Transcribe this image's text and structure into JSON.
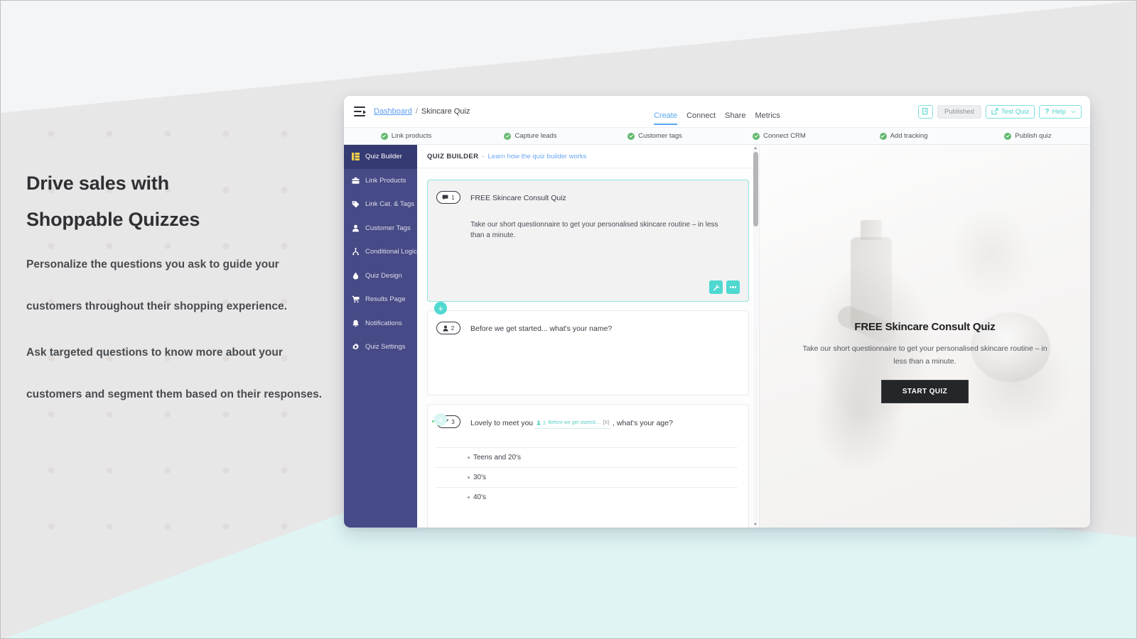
{
  "marketing": {
    "heading_line1": "Drive sales with",
    "heading_line2": "Shoppable Quizzes",
    "paragraph1": "Personalize the questions you ask to guide your customers throughout their shopping experience.",
    "paragraph2": "Ask targeted questions to know more about your customers and segment them based on their responses."
  },
  "topbar": {
    "menu_icon": "hamburger-menu-icon",
    "breadcrumb": {
      "root": "Dashboard",
      "separator": "/",
      "current": "Skincare Quiz"
    },
    "nav": [
      {
        "label": "Create",
        "active": true
      },
      {
        "label": "Connect",
        "active": false
      },
      {
        "label": "Share",
        "active": false
      },
      {
        "label": "Metrics",
        "active": false
      }
    ],
    "actions": {
      "duplicate_icon": "copy-page-icon",
      "published_label": "Published",
      "test_quiz_label": "Test Quiz",
      "test_quiz_icon": "external-link-icon",
      "help_label": "Help",
      "help_icon": "question-mark-icon",
      "help_chevron_icon": "chevron-down-icon"
    }
  },
  "checklist": [
    {
      "label": "Link products",
      "done": true
    },
    {
      "label": "Capture leads",
      "done": true
    },
    {
      "label": "Customer tags",
      "done": true
    },
    {
      "label": "Connect CRM",
      "done": true
    },
    {
      "label": "Add tracking",
      "done": true
    },
    {
      "label": "Publish quiz",
      "done": true
    }
  ],
  "sidebar": {
    "items": [
      {
        "label": "Quiz Builder",
        "icon": "grid-blocks-icon",
        "active": true
      },
      {
        "label": "Link Products",
        "icon": "briefcase-icon",
        "active": false
      },
      {
        "label": "Link Cat. & Tags",
        "icon": "tag-icon",
        "active": false
      },
      {
        "label": "Customer Tags",
        "icon": "person-icon",
        "active": false
      },
      {
        "label": "Conditional Logic",
        "icon": "branch-icon",
        "active": false
      },
      {
        "label": "Quiz Design",
        "icon": "droplet-icon",
        "active": false
      },
      {
        "label": "Results Page",
        "icon": "shopping-cart-icon",
        "active": false
      },
      {
        "label": "Notifications",
        "icon": "bell-icon",
        "active": false
      },
      {
        "label": "Quiz Settings",
        "icon": "gear-icon",
        "active": false
      }
    ]
  },
  "builder": {
    "header_title": "QUIZ BUILDER",
    "header_dash": "-",
    "header_link": "Learn how the quiz builder works",
    "cards": [
      {
        "badge_number": "1",
        "badge_icon": "speech-bubble-icon",
        "title": "FREE Skincare Consult Quiz",
        "description": "Take our short questionnaire to get your personalised skincare routine – in less than a minute.",
        "selected": true,
        "actions": {
          "edit_icon": "wrench-icon",
          "more_icon": "ellipsis-icon"
        }
      },
      {
        "badge_number": "2",
        "badge_icon": "person-icon",
        "title": "Before we get started... what's your name?",
        "selected": false
      },
      {
        "badge_number": "3",
        "badge_icon": "checkmark-icon",
        "title_prefix": "Lovely to meet you",
        "title_suffix": ", what's your age?",
        "condition_tag": {
          "number": "2",
          "icon": "person-icon",
          "text": "Before we get started....",
          "remove_label": "[X]"
        },
        "answers": [
          "Teens and 20's",
          "30's",
          "40's"
        ],
        "selected": false
      }
    ],
    "add_button_label": "+"
  },
  "preview": {
    "title": "FREE Skincare Consult Quiz",
    "subtitle": "Take our short questionnaire to get your personalised skincare routine – in less than a minute.",
    "cta_label": "START QUIZ"
  },
  "colors": {
    "sidebar_bg": "#464a86",
    "sidebar_active": "#353a73",
    "accent_teal": "#4fd8d0",
    "accent_blue": "#59a7f0",
    "check_green": "#63b96f",
    "cta_dark": "#25262a",
    "page_bg": "#f4f5f7",
    "wedge_grey": "#e7e7e7",
    "wedge_teal": "#dff4f3"
  }
}
